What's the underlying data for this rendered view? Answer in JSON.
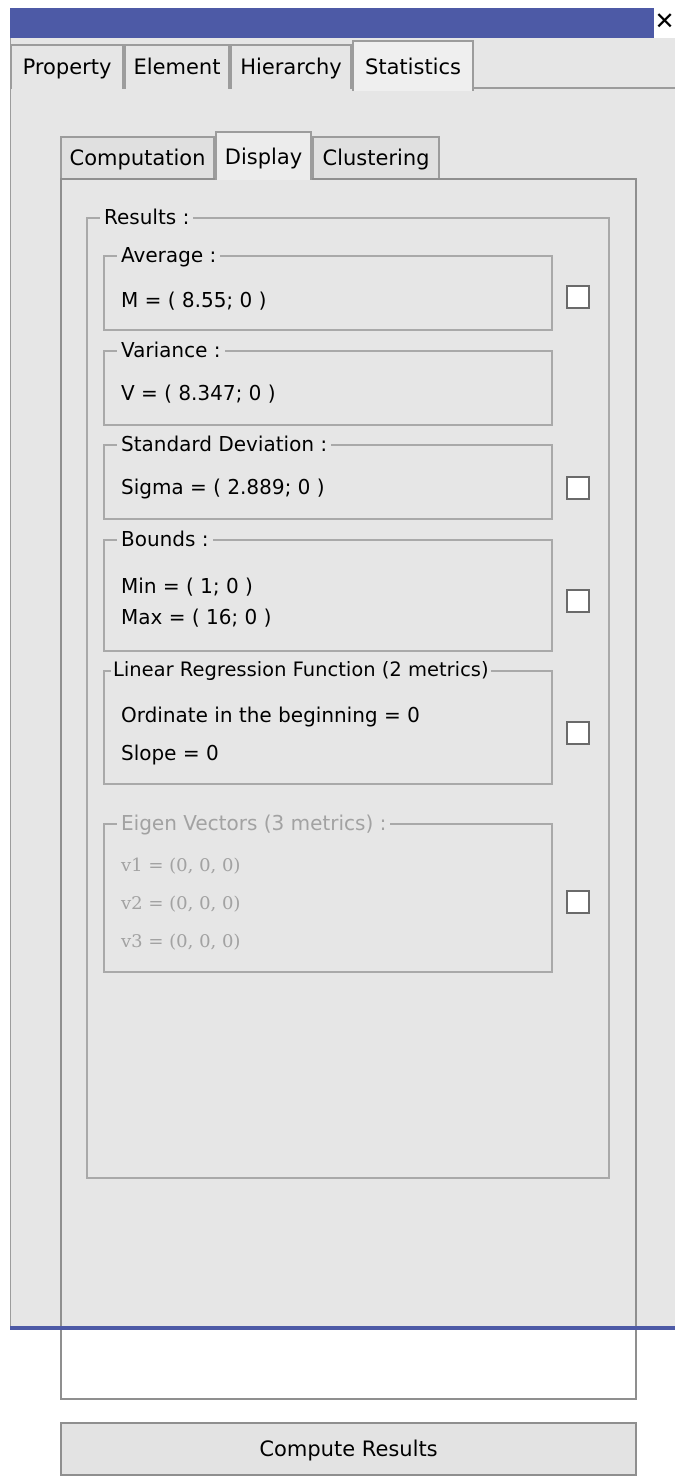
{
  "window": {
    "close_glyph": "✕"
  },
  "top_tabs": [
    "Property",
    "Element",
    "Hierarchy",
    "Statistics"
  ],
  "inner_tabs": [
    "Computation",
    "Display",
    "Clustering"
  ],
  "results": {
    "legend": "Results :",
    "average": {
      "legend": "Average :",
      "value": "M = ( 8.55; 0 )"
    },
    "variance": {
      "legend": "Variance :",
      "value": "V = ( 8.347; 0 )"
    },
    "std_dev": {
      "legend": "Standard Deviation :",
      "value": "Sigma = ( 2.889; 0 )"
    },
    "bounds": {
      "legend": "Bounds :",
      "min": "Min = ( 1; 0 )",
      "max": "Max = ( 16; 0 )"
    },
    "regression": {
      "legend": "Linear Regression Function (2 metrics)",
      "ordinate": "Ordinate in the beginning = 0",
      "slope": "Slope = 0"
    },
    "eigen": {
      "legend": "Eigen Vectors (3 metrics) :",
      "v1": "v1 = (0, 0, 0)",
      "v2": "v2 = (0, 0, 0)",
      "v3": "v3 = (0, 0, 0)"
    }
  },
  "compute_button": "Compute Results"
}
